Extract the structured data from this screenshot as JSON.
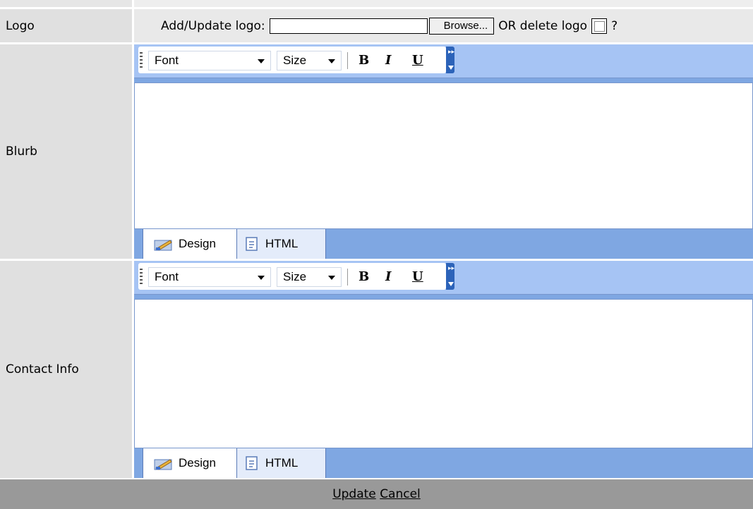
{
  "rows": {
    "logo": {
      "label": "Logo",
      "add_update_text": "Add/Update logo:",
      "browse_label": "Browse...",
      "or_delete_text": "OR delete logo",
      "help_mark": "?"
    },
    "blurb": {
      "label": "Blurb"
    },
    "contact": {
      "label": "Contact Info"
    }
  },
  "editor": {
    "font_select": "Font",
    "size_select": "Size",
    "bold": "B",
    "italic": "I",
    "underline": "U",
    "tab_design": "Design",
    "tab_html": "HTML"
  },
  "footer": {
    "update_label": "Update",
    "cancel_label": "Cancel"
  },
  "colors": {
    "label_bg": "#e0e0e0",
    "toolbar_bg": "#a6c4f4",
    "tabbar_bg": "#7fa7e2",
    "footer_bg": "#999999"
  },
  "icons": {
    "design_tab": "design-icon",
    "html_tab": "html-icon",
    "toolbar_overflow": "toolbar-options-icon"
  }
}
